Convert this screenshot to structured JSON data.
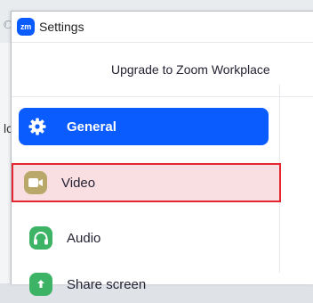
{
  "window": {
    "title": "Settings",
    "logo_text": "zm"
  },
  "banner": {
    "upgrade_text": "Upgrade to Zoom Workplace"
  },
  "background": {
    "partial_letter": "lc"
  },
  "sidebar": {
    "items": [
      {
        "label": "General",
        "icon": "gear-icon",
        "selected": true
      },
      {
        "label": "Video",
        "icon": "video-camera-icon",
        "highlighted": true
      },
      {
        "label": "Audio",
        "icon": "headphones-icon"
      },
      {
        "label": "Share screen",
        "icon": "share-screen-icon"
      }
    ]
  },
  "colors": {
    "accent": "#0b5cff",
    "highlight_border": "#e3262f",
    "highlight_fill": "#f9dfe1",
    "audio_icon": "#3db366",
    "video_icon": "#b9a86a"
  }
}
